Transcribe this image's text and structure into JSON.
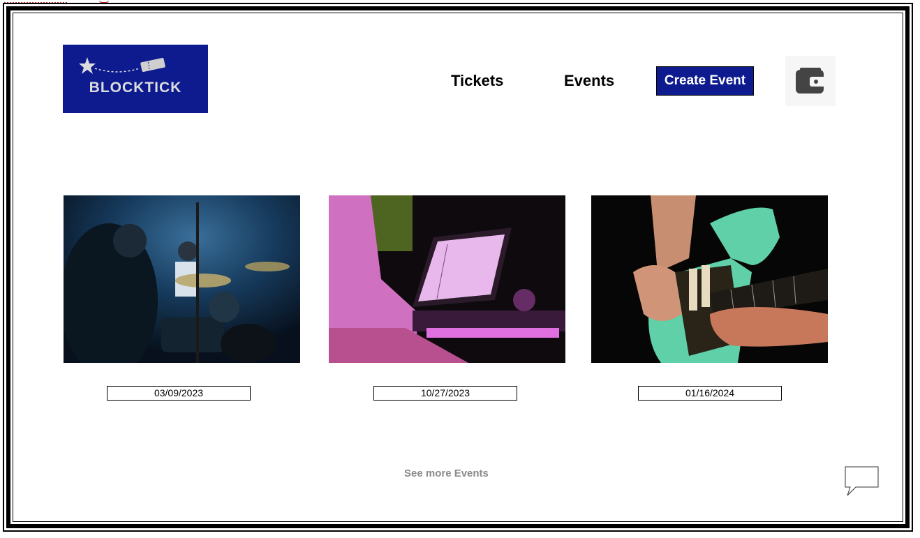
{
  "brand": {
    "name": "BLOCKTICK",
    "color": "#0d1b8f"
  },
  "nav": {
    "tickets": "Tickets",
    "events": "Events",
    "create_event": "Create Event",
    "wallet_icon": "wallet-icon"
  },
  "events": [
    {
      "image": "drummer-concert-photo",
      "date": "03/09/2023"
    },
    {
      "image": "keyboard-player-photo",
      "date": "10/27/2023"
    },
    {
      "image": "guitarist-photo",
      "date": "01/16/2024"
    }
  ],
  "see_more": "See more Events",
  "chat_icon": "speech-bubble-icon"
}
